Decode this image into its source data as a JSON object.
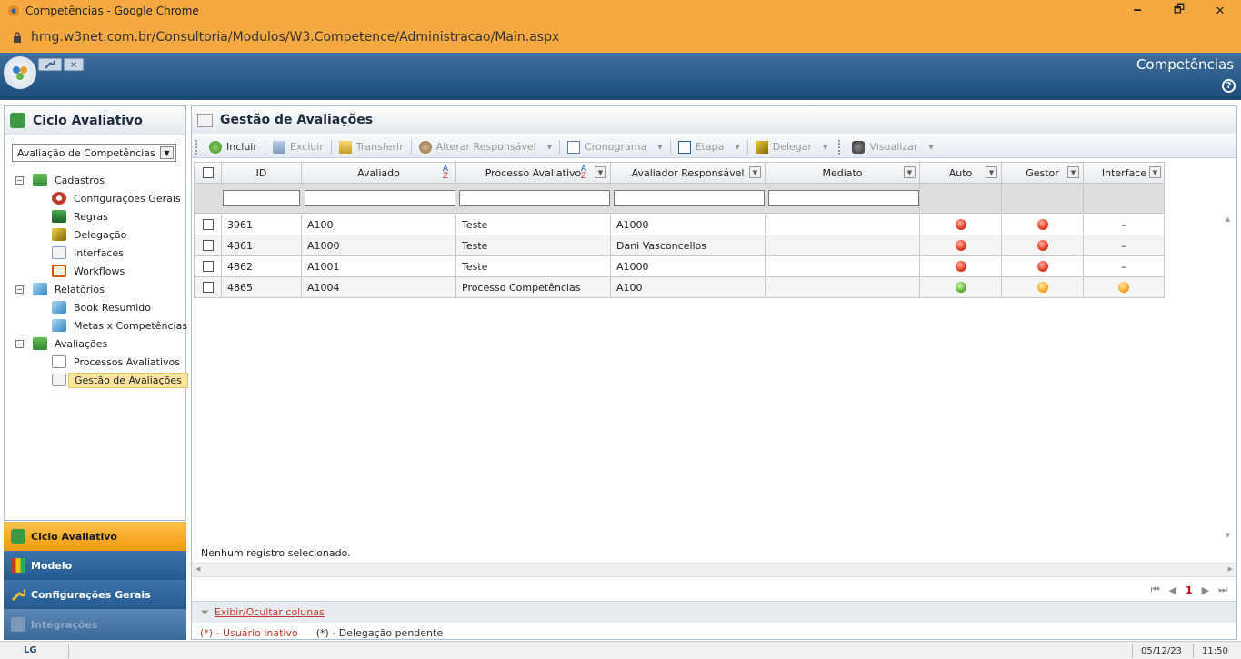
{
  "browser": {
    "window_title": "Competências - Google Chrome",
    "url": "hmg.w3net.com.br/Consultoria/Modulos/W3.Competence/Administracao/Main.aspx",
    "minimize": "🗕",
    "maximize": "🗗",
    "close": "✕"
  },
  "app": {
    "title": "Competências",
    "help": "?",
    "tab_close": "×"
  },
  "left_panel": {
    "title": "Ciclo Avaliativo",
    "select_value": "Avaliação de Competências",
    "select_arrow": "▼",
    "tree": {
      "cadastros": {
        "label": "Cadastros",
        "expander": "−"
      },
      "configuracoes": "Configurações Gerais",
      "regras": "Regras",
      "delegacao": "Delegação",
      "interfaces": "Interfaces",
      "workflows": "Workflows",
      "relatorios": {
        "label": "Relatórios",
        "expander": "−"
      },
      "book": "Book Resumido",
      "metas": "Metas x Competências",
      "avaliacoes": {
        "label": "Avaliações",
        "expander": "−"
      },
      "processos": "Processos Avaliativos",
      "gestao": "Gestão de Avaliações"
    }
  },
  "accordion": {
    "ciclo": "Ciclo Avaliativo",
    "modelo": "Modelo",
    "config": "Configurações Gerais",
    "integracoes": "Integrações"
  },
  "main": {
    "title": "Gestão de Avaliações",
    "toolbar": {
      "incluir": "Incluir",
      "excluir": "Excluir",
      "transferir": "Transferir",
      "alterar": "Alterar Responsável",
      "cronograma": "Cronograma",
      "etapa": "Etapa",
      "delegar": "Delegar",
      "visualizar": "Visualizar",
      "caret": "▼"
    },
    "columns": {
      "id": "ID",
      "avaliado": "Avaliado",
      "processo": "Processo Avaliativo",
      "responsavel": "Avaliador Responsável",
      "mediato": "Mediato",
      "auto": "Auto",
      "gestor": "Gestor",
      "interface": "Interface",
      "filter_btn": "▼",
      "sort_a": "A",
      "sort_z": "Z"
    },
    "rows": [
      {
        "id": "3961",
        "avaliado": "A100",
        "processo": "Teste",
        "responsavel": "A1000",
        "mediato": "",
        "auto": "red",
        "gestor": "red",
        "interface": "–"
      },
      {
        "id": "4861",
        "avaliado": "A1000",
        "processo": "Teste",
        "responsavel": "Dani Vasconcellos",
        "mediato": "",
        "auto": "red",
        "gestor": "red",
        "interface": "–"
      },
      {
        "id": "4862",
        "avaliado": "A1001",
        "processo": "Teste",
        "responsavel": "A1000",
        "mediato": "",
        "auto": "red",
        "gestor": "red",
        "interface": "–"
      },
      {
        "id": "4865",
        "avaliado": "A1004",
        "processo": "Processo Competências",
        "responsavel": "A100",
        "mediato": "",
        "auto": "green",
        "gestor": "orange",
        "interface": "orange"
      }
    ],
    "status_message": "Nenhum registro selecionado.",
    "pager": {
      "first": "⏮",
      "prev": "◀",
      "current": "1",
      "next": "▶",
      "last": "⏭"
    },
    "scroll": {
      "up": "▲",
      "down": "▼",
      "left": "◀",
      "right": "▶"
    },
    "toggle_columns": "Exibir/Ocultar colunas",
    "legend_inativo": "(*) - Usuário inativo",
    "legend_delegacao": "(*) - Delegação pendente"
  },
  "statusbar": {
    "logo": "LG",
    "date": "05/12/23",
    "time": "11:50"
  },
  "colors": {
    "chrome_title": "#f6a940",
    "app_header": "#1f4d7c",
    "accordion_active": "#f7a51c",
    "accordion_inactive": "#2a5f94",
    "selection": "#fbe3a0"
  }
}
